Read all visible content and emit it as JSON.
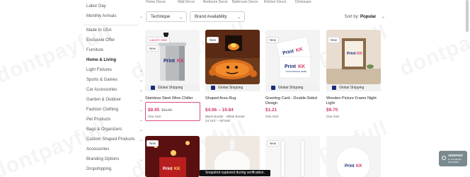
{
  "sidebar": {
    "items": [
      {
        "label": "Labor Day",
        "chevron": false
      },
      {
        "label": "Monthly Arrivals",
        "chevron": true
      },
      {
        "label": "Made In USA",
        "chevron": false
      },
      {
        "label": "Exclusive Offer",
        "chevron": false
      },
      {
        "label": "Furniture",
        "chevron": false
      },
      {
        "label": "Home & Living",
        "chevron": false,
        "active": true
      },
      {
        "label": "Light Fixtures",
        "chevron": true
      },
      {
        "label": "Sports & Games",
        "chevron": true
      },
      {
        "label": "Car Accessories",
        "chevron": true
      },
      {
        "label": "Garden & Outdoor",
        "chevron": true
      },
      {
        "label": "Fashion Clothing",
        "chevron": true
      },
      {
        "label": "Pet Products",
        "chevron": true
      },
      {
        "label": "Bags & Organizers",
        "chevron": true
      },
      {
        "label": "Custom Shaped Products",
        "chevron": true
      },
      {
        "label": "Accessories",
        "chevron": false
      },
      {
        "label": "Branding Options",
        "chevron": true
      },
      {
        "label": "Dropshipping",
        "chevron": false
      }
    ]
  },
  "topnav": [
    "Home Decor",
    "Wall Decor",
    "Bedroom Decor",
    "Bathroom Decor",
    "Kitchen Decor",
    "Drinkware"
  ],
  "filters": {
    "technique": "Technique",
    "brand": "Brand Availability"
  },
  "sort": {
    "label": "Sort by:",
    "value": "Popular"
  },
  "products": [
    {
      "title": "Stainless Steel Wine Chiller",
      "price": "$8.95",
      "old_price": "$11.59",
      "meta": "One Size",
      "badges": [
        "Launch Sale",
        "New"
      ],
      "shipping": "Global Shipping"
    },
    {
      "title": "Shaped Area Rug",
      "price": "$4.96 – 19.84",
      "old_price": "",
      "meta": "Black Border · White Border\n24\"x24\" – 60\"x60\"",
      "badges": [
        "New"
      ],
      "shipping": "Global Shipping"
    },
    {
      "title": "Greeting Card - Double-Sided Design",
      "price": "$1.21",
      "old_price": "",
      "meta": "One Size",
      "badges": [
        "New"
      ],
      "shipping": "Global Shipping"
    },
    {
      "title": "Wooden Picture Frame Night Light",
      "price": "$9.70",
      "old_price": "",
      "meta": "One Size",
      "badges": [
        "New"
      ],
      "shipping": "Global Shipping"
    }
  ],
  "row2_badges": [
    "New",
    "New"
  ],
  "brand_logo": {
    "main": "Print",
    "accent": "KK",
    "tagline": "YOUR DESIGN HERE"
  },
  "watermark": "dontpayfull",
  "snapshot": "Snapshot captured during verification.",
  "verified": {
    "title": "VERIFIED",
    "line1": "by dontpayfull",
    "line2": "09/17/2025"
  },
  "colors": {
    "accent": "#d23b6e",
    "brand_navy": "#1a2b7a",
    "highlight": "#e0507a"
  }
}
